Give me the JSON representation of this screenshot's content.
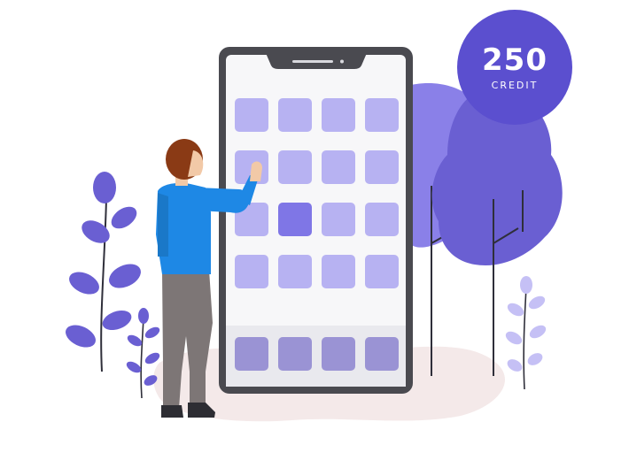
{
  "badge": {
    "amount": "250",
    "label": "CREDIT"
  },
  "phone": {
    "rows": 4,
    "cols": 4,
    "dock_count": 4,
    "selected_tile": {
      "row": 2,
      "col": 1
    }
  },
  "colors": {
    "badge": "#5b4fcf",
    "tile": "#b7b2f2",
    "tile_selected": "#7f76e6",
    "dock_tile": "#9a93d4",
    "tree_back": "#8a80e8",
    "tree_front": "#6a5fd2",
    "plant_leaf": "#6a5fd2",
    "plant_leaf_light": "#c5c0f5",
    "phone_frame": "#4a4a50",
    "shirt": "#1e88e5",
    "pants": "#7d7676",
    "hair": "#8a3a15",
    "ground": "#f3e7e7"
  }
}
